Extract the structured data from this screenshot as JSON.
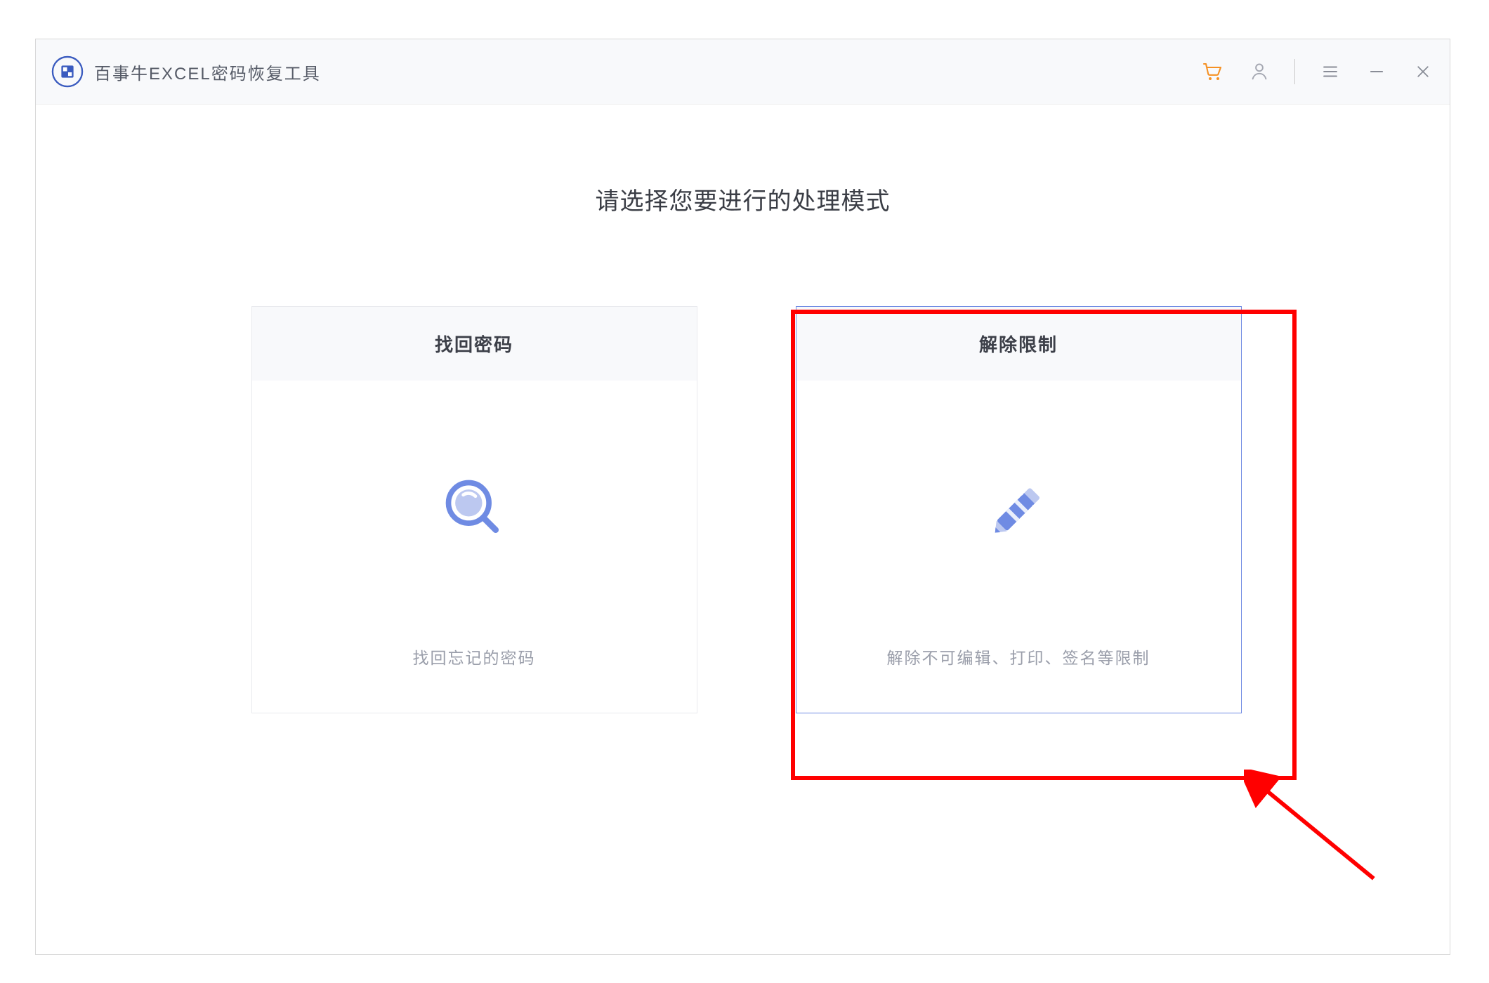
{
  "titlebar": {
    "app_title": "百事牛EXCEL密码恢复工具",
    "icons": {
      "cart": "cart-icon",
      "user": "user-icon",
      "menu": "menu-icon",
      "minimize": "minimize-icon",
      "close": "close-icon"
    }
  },
  "main": {
    "heading": "请选择您要进行的处理模式",
    "cards": [
      {
        "id": "recover",
        "title": "找回密码",
        "desc": "找回忘记的密码",
        "icon": "search-icon",
        "selected": false
      },
      {
        "id": "unlock",
        "title": "解除限制",
        "desc": "解除不可编辑、打印、签名等限制",
        "icon": "pencil-icon",
        "selected": true
      }
    ]
  },
  "annotation": {
    "highlight_target": "unlock-card",
    "arrow": true
  },
  "colors": {
    "accent": "#6f8be3",
    "cart": "#f59124",
    "highlight": "#ff0000",
    "muted": "#9a9eaa"
  }
}
